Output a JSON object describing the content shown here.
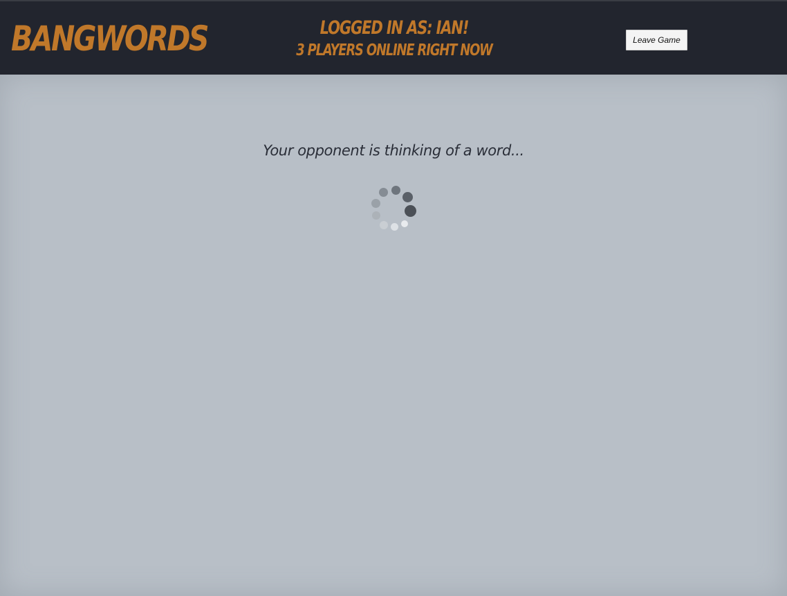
{
  "header": {
    "logo_text": "Bangwords",
    "status_line1": "Logged in as: Ian!",
    "status_line2": "3 players online right now",
    "leave_button_label": "Leave Game"
  },
  "main": {
    "waiting_message": "Your opponent is thinking of a word..."
  },
  "colors": {
    "header_bg": "#22252e",
    "accent_orange": "#c0782a",
    "page_bg": "#b8bfc7",
    "message_text": "#2a2e38"
  },
  "icons": {
    "spinner": "loading-spinner-icon"
  }
}
